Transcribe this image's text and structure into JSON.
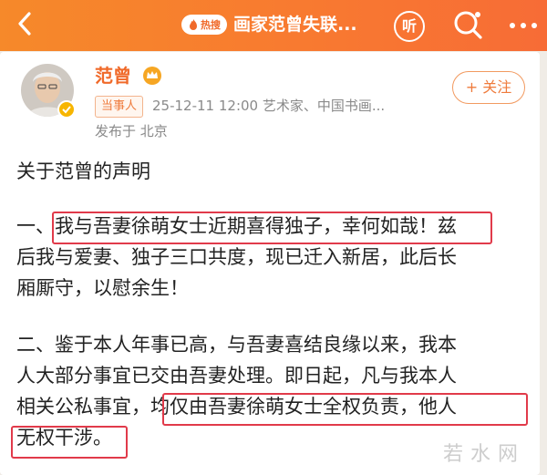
{
  "header": {
    "hot_label": "热搜",
    "title": "画家范曾失联...",
    "listen_label": "听"
  },
  "post": {
    "author_name": "范曾",
    "role_tag": "当事人",
    "meta_line": "25-12-11 12:00  艺术家、中国书画...",
    "posted_from": "发布于 北京",
    "follow_label": "+ 关注"
  },
  "content": {
    "heading": "关于范曾的声明",
    "p1_prefix": "一、",
    "p1_highlight": "我与吾妻徐萌女士近期喜得独子，幸何如哉！",
    "p1_suffix": "兹",
    "p1_line2": "后我与爱妻、独子三口共度，现已迁入新居，此后长",
    "p1_line3": "厢厮守，以慰余生！",
    "p2_line1": "二、鉴于本人年事已高，与吾妻喜结良缘以来，我本",
    "p2_line2": "人大部分事宜已交由吾妻处理。即日起，凡与我本人",
    "p2_line3_prefix": "相关公私事宜，",
    "p2_highlight_a": "均仅由吾妻徐萌女士全权负责，他人",
    "p2_highlight_b": "无权干涉。"
  },
  "watermark": "若水网",
  "colors": {
    "brand_orange": "#f6892a",
    "highlight_red": "#e13a4a",
    "name_orange": "#f06a2a"
  },
  "icons": {
    "back": "chevron-left-icon",
    "hot": "flame-icon",
    "listen": "headphones-icon",
    "search": "search-icon",
    "more": "more-dots-icon",
    "verified": "verified-badge-icon",
    "crown": "crown-icon"
  }
}
